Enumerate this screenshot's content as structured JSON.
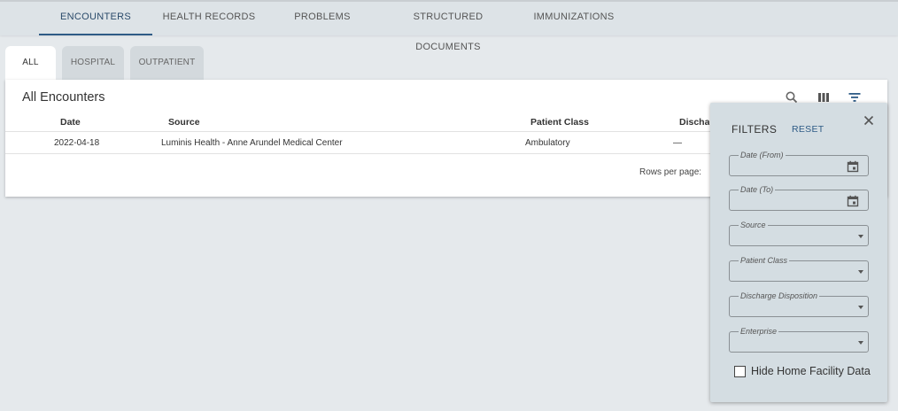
{
  "nav": {
    "tabs": [
      "ENCOUNTERS",
      "HEALTH RECORDS",
      "PROBLEMS",
      "STRUCTURED DOCUMENTS",
      "IMMUNIZATIONS"
    ],
    "active": "ENCOUNTERS"
  },
  "subtabs": {
    "items": [
      "ALL",
      "HOSPITAL",
      "OUTPATIENT"
    ],
    "active": "ALL"
  },
  "card": {
    "title": "All Encounters",
    "columns": [
      "Date",
      "Source",
      "Patient Class",
      "Discharge Disposition"
    ],
    "rows": [
      {
        "date": "2022-04-18",
        "source": "Luminis Health - Anne Arundel Medical Center",
        "patient_class": "Ambulatory",
        "discharge": "—"
      }
    ],
    "rows_per_page_label": "Rows per page:"
  },
  "filters": {
    "title": "FILTERS",
    "reset": "RESET",
    "fields": [
      "Date (From)",
      "Date (To)",
      "Source",
      "Patient Class",
      "Discharge Disposition",
      "Enterprise"
    ],
    "checkbox_label": "Hide Home Facility Data",
    "checkbox_checked": false
  },
  "icons": [
    "search-icon",
    "columns-icon",
    "filter-icon",
    "close-icon",
    "calendar-icon",
    "dropdown-caret-icon"
  ],
  "colors": {
    "accent": "#2e5b86",
    "background": "#e5e9ec",
    "panel": "#d4dde2"
  }
}
